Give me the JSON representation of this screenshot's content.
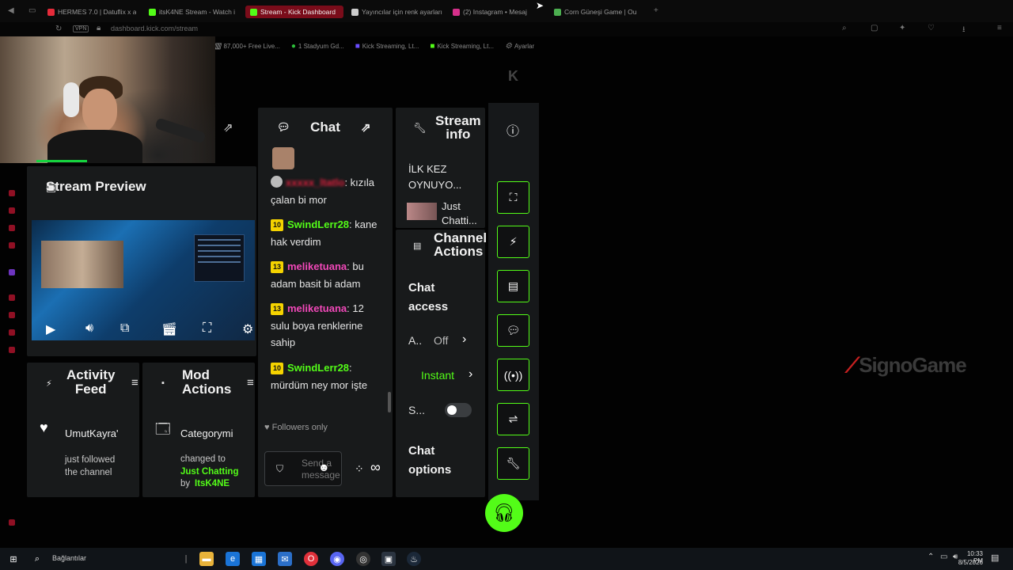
{
  "browser": {
    "tabs": [
      {
        "label": "HERMES 7.0 | Datuflix x a",
        "color": "#e52b3a"
      },
      {
        "label": "itsK4NE Stream - Watch i",
        "color": "#53fc18"
      },
      {
        "label": "Stream - Kick Dashboard",
        "color": "#53fc18"
      },
      {
        "label": "Yayıncılar için renk ayarları",
        "color": "#cccccc"
      },
      {
        "label": "(2) Instagram • Mesaj",
        "color": "#d6308b"
      },
      {
        "label": "Corn Güneşi Game | Ou",
        "color": "#4caf50"
      }
    ],
    "url": "dashboard.kick.com/stream",
    "vpn": "VPN",
    "bookmarks": [
      {
        "label": "87,000+ Free Live..."
      },
      {
        "label": "1 Stadyum Gd..."
      },
      {
        "label": "Kick Streaming, Lt..."
      },
      {
        "label": "Kick Streaming, Lt..."
      },
      {
        "label": "Ayarlar"
      }
    ]
  },
  "panels": {
    "stream_preview": {
      "title": "Stream Preview"
    },
    "chat": {
      "title": "Chat"
    },
    "stream_info": {
      "title_line1": "Stream",
      "title_line2": "info",
      "stream_title": "İLK KEZ OYNUYO...",
      "category": "Just Chatti..."
    },
    "channel_actions": {
      "title_line1": "Channel",
      "title_line2": "Actions"
    },
    "activity_feed": {
      "title_line1": "Activity",
      "title_line2": "Feed",
      "item_user": "UmutKayra'",
      "item_text": "just followed the channel"
    },
    "mod_actions": {
      "title_line1": "Mod",
      "title_line2": "Actions",
      "item_title": "Categorymi",
      "item_text": "changed to",
      "item_value": "Just Chatting",
      "item_by": "by",
      "item_mod": "ItsK4NE"
    }
  },
  "chat": {
    "messages": [
      {
        "badge": "",
        "user": "",
        "text": "kızıla çalan bi mor",
        "user_color": "red"
      },
      {
        "badge": "10",
        "user": "SwindLerr28",
        "text": "kane hak verdim",
        "user_color": "green"
      },
      {
        "badge": "13",
        "user": "meliketuana",
        "text": "bu adam basit bi adam",
        "user_color": "pink"
      },
      {
        "badge": "13",
        "user": "meliketuana",
        "text": "12 sulu boya renklerine sahip",
        "user_color": "pink"
      },
      {
        "badge": "10",
        "user": "SwindLerr28",
        "text": "mürdüm ney mor işte",
        "user_color": "green"
      }
    ],
    "followers_only": "Followers only",
    "input_placeholder": "Send a message"
  },
  "channel_actions": {
    "chat_access": "Chat access",
    "row1_label": "A..",
    "row1_value": "Off",
    "row2_value": "Instant",
    "row3_label": "S...",
    "chat_options": "Chat options"
  },
  "watermark": "SignoGame",
  "taskbar": {
    "search_text": "Bağlantılar",
    "time": "10:33 PM",
    "date": "8/5/2026"
  },
  "colors": {
    "accent": "#53fc18",
    "panel": "#181a1b"
  }
}
